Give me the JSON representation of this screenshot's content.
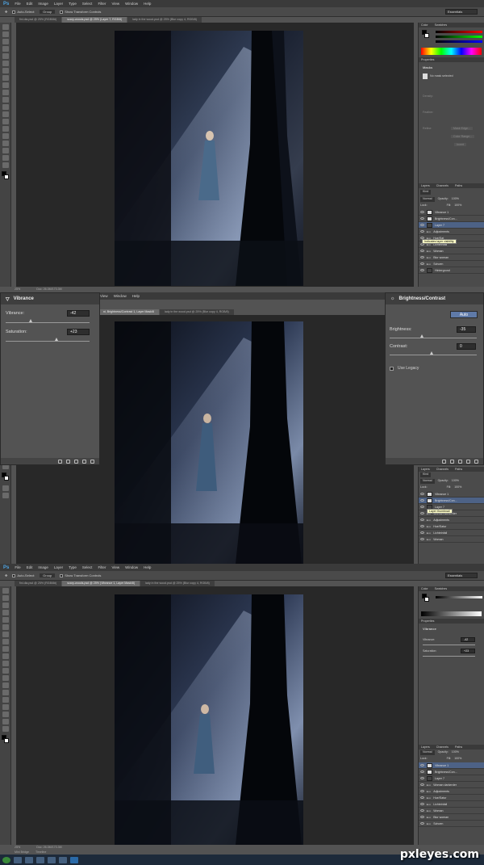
{
  "menu": [
    "Ps",
    "File",
    "Edit",
    "Image",
    "Layer",
    "Type",
    "Select",
    "Filter",
    "View",
    "Window",
    "Help"
  ],
  "options": {
    "auto_select": "Auto-Select:",
    "auto_select_value": "Group",
    "show_transform": "Show Transform Controls",
    "workspace": "Essentials"
  },
  "tabs_top": [
    "fini.dia.psd @ 25% (RGB/8#)",
    "scary-woods.psd @ 25% (Layer 7, RGB/8)",
    "lady in the wood.psd @ 25% (Blur copy 4, RGB/8)"
  ],
  "tabs_bottom": [
    "fini.dia.psd @ 25% (RGB/8#)",
    "scary-woods.psd @ 25% (Vibrance 1, Layer Mask/8)",
    "lady in the wood.psd @ 25% (Blur copy 4, RGB/8)"
  ],
  "tabs_mid": [
    "ni, Brightness/Contrast 1, Layer Mask/8",
    "lady in the wood.psd @ 25% (Blur copy 4, RGB/8)"
  ],
  "panels": {
    "color": "Color",
    "swatches": "Swatches",
    "properties": "Properties",
    "masks": "Masks",
    "no_mask": "No mask selected",
    "density": "Density:",
    "feather": "Feather:",
    "refine": "Refine:",
    "mask_edge": "Mask Edge...",
    "color_range": "Color Range...",
    "invert": "Invert",
    "layers": "Layers",
    "channels": "Channels",
    "paths": "Paths",
    "kind": "Kind",
    "normal": "Normal",
    "opacity": "Opacity:",
    "opacity_val": "100%",
    "lock": "Lock:",
    "fill": "Fill:",
    "fill_val": "100%",
    "tooltip_top": "Indicates layer visibility",
    "tooltip_mid": "Layer thumbnail",
    "vibrance_panel_title": "Vibrance",
    "vibrance_val_small": "-42",
    "saturation_val_small": "+23"
  },
  "layers_top": [
    "Vibrance 1",
    "Brightness/Con...",
    "Layer 7",
    "Adjustments",
    "Hue/Sat",
    "Lichteinfall",
    "Woman",
    "Blur woman",
    "Schoen",
    "Hintergrund"
  ],
  "layers_mid": [
    "Vibrance 1",
    "Brightness/Con...",
    "Layer 7",
    "Woman darkerder",
    "Adjustments",
    "Hue/Satur",
    "Lichteinfall",
    "Woman"
  ],
  "layers_bottom": [
    "Vibrance 1",
    "Brightness/Con...",
    "Layer 7",
    "Woman darkerder",
    "Adjustments",
    "Hue/Satur",
    "Lichteinfall",
    "Woman",
    "Blur woman",
    "Schoen"
  ],
  "vibrance": {
    "title": "Vibrance",
    "vibrance_label": "Vibrance:",
    "vibrance_value": "-42",
    "saturation_label": "Saturation:",
    "saturation_value": "+23"
  },
  "brightness": {
    "title": "Brightness/Contrast",
    "auto": "Auto",
    "brightness_label": "Brightness:",
    "brightness_value": "-35",
    "contrast_label": "Contrast:",
    "contrast_value": "0",
    "legacy": "Use Legacy"
  },
  "mid_menu": [
    "View",
    "Window",
    "Help"
  ],
  "status_top": {
    "zoom": "25%",
    "doc": "Doc: 26.3M/173.3M"
  },
  "status_bottom": {
    "zoom": "25%",
    "doc": "Doc: 26.3M/173.3M"
  },
  "bottom_tabs": [
    "Mini Bridge",
    "Timeline"
  ],
  "watermark": "pxleyes.com",
  "colors": {
    "accent": "#5f7aa8",
    "selected_layer": "#4d6286",
    "panel": "#535353"
  }
}
